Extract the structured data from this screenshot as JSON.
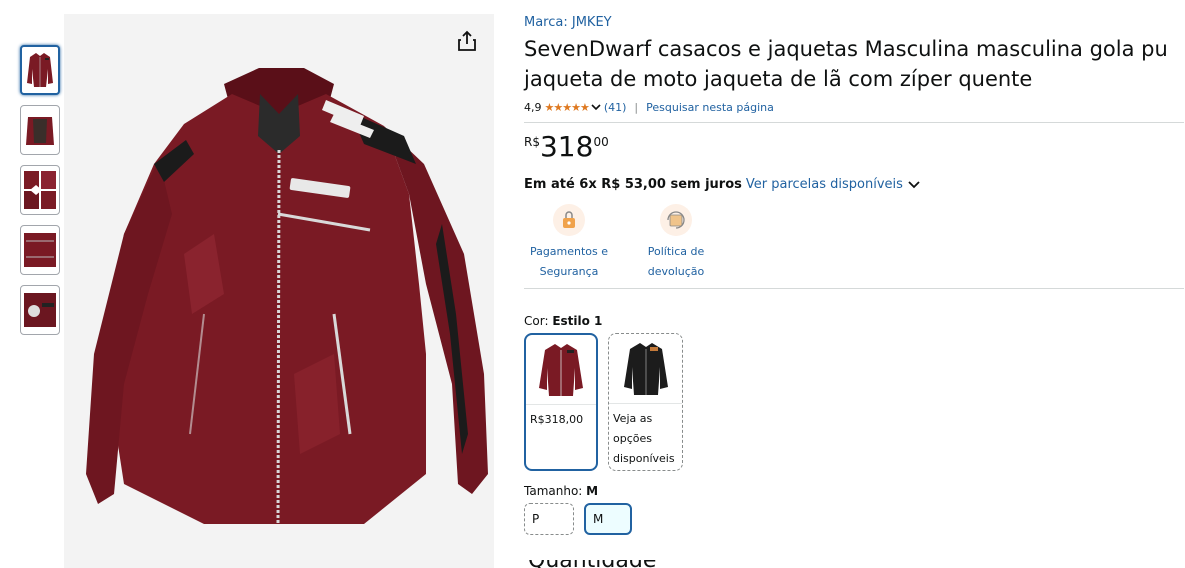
{
  "product": {
    "brand": "Marca: JMKEY",
    "title": "SevenDwarf casacos e jaquetas Masculina masculina gola pu jaqueta de moto jaqueta de lã com zíper quente",
    "rating": "4,9",
    "stars": "★★★★★",
    "review_count": "(41)",
    "separator": "|",
    "search_page": "Pesquisar nesta página",
    "price": {
      "symbol": "R$",
      "whole": "318",
      "fraction": "00"
    },
    "installments": {
      "bold": "Em até 6x R$ 53,00 sem juros",
      "link": "Ver parcelas disponíveis"
    },
    "badges": [
      {
        "line1": "Pagamentos e",
        "line2": "Segurança",
        "icon": "lock-payment-icon"
      },
      {
        "line1": "Política de",
        "line2": "devolução",
        "icon": "return-box-icon"
      }
    ],
    "color": {
      "label": "Cor: ",
      "value": "Estilo 1",
      "options": [
        {
          "text": "R$318,00",
          "selected": true,
          "jacket_color": "#7a1a24"
        },
        {
          "line1": "Veja as",
          "line2": "opções",
          "line3": "disponíveis",
          "selected": false,
          "jacket_color": "#1c1c1c"
        }
      ]
    },
    "size": {
      "label": "Tamanho: ",
      "value": "M",
      "options": [
        {
          "text": "P",
          "selected": false
        },
        {
          "text": "M",
          "selected": true
        }
      ]
    },
    "cut_off_heading": "Quantidade"
  },
  "colors": {
    "link": "#2162a1",
    "star": "#de7921",
    "jacket_main": "#7a1a24",
    "selected_border": "#2162a1"
  }
}
